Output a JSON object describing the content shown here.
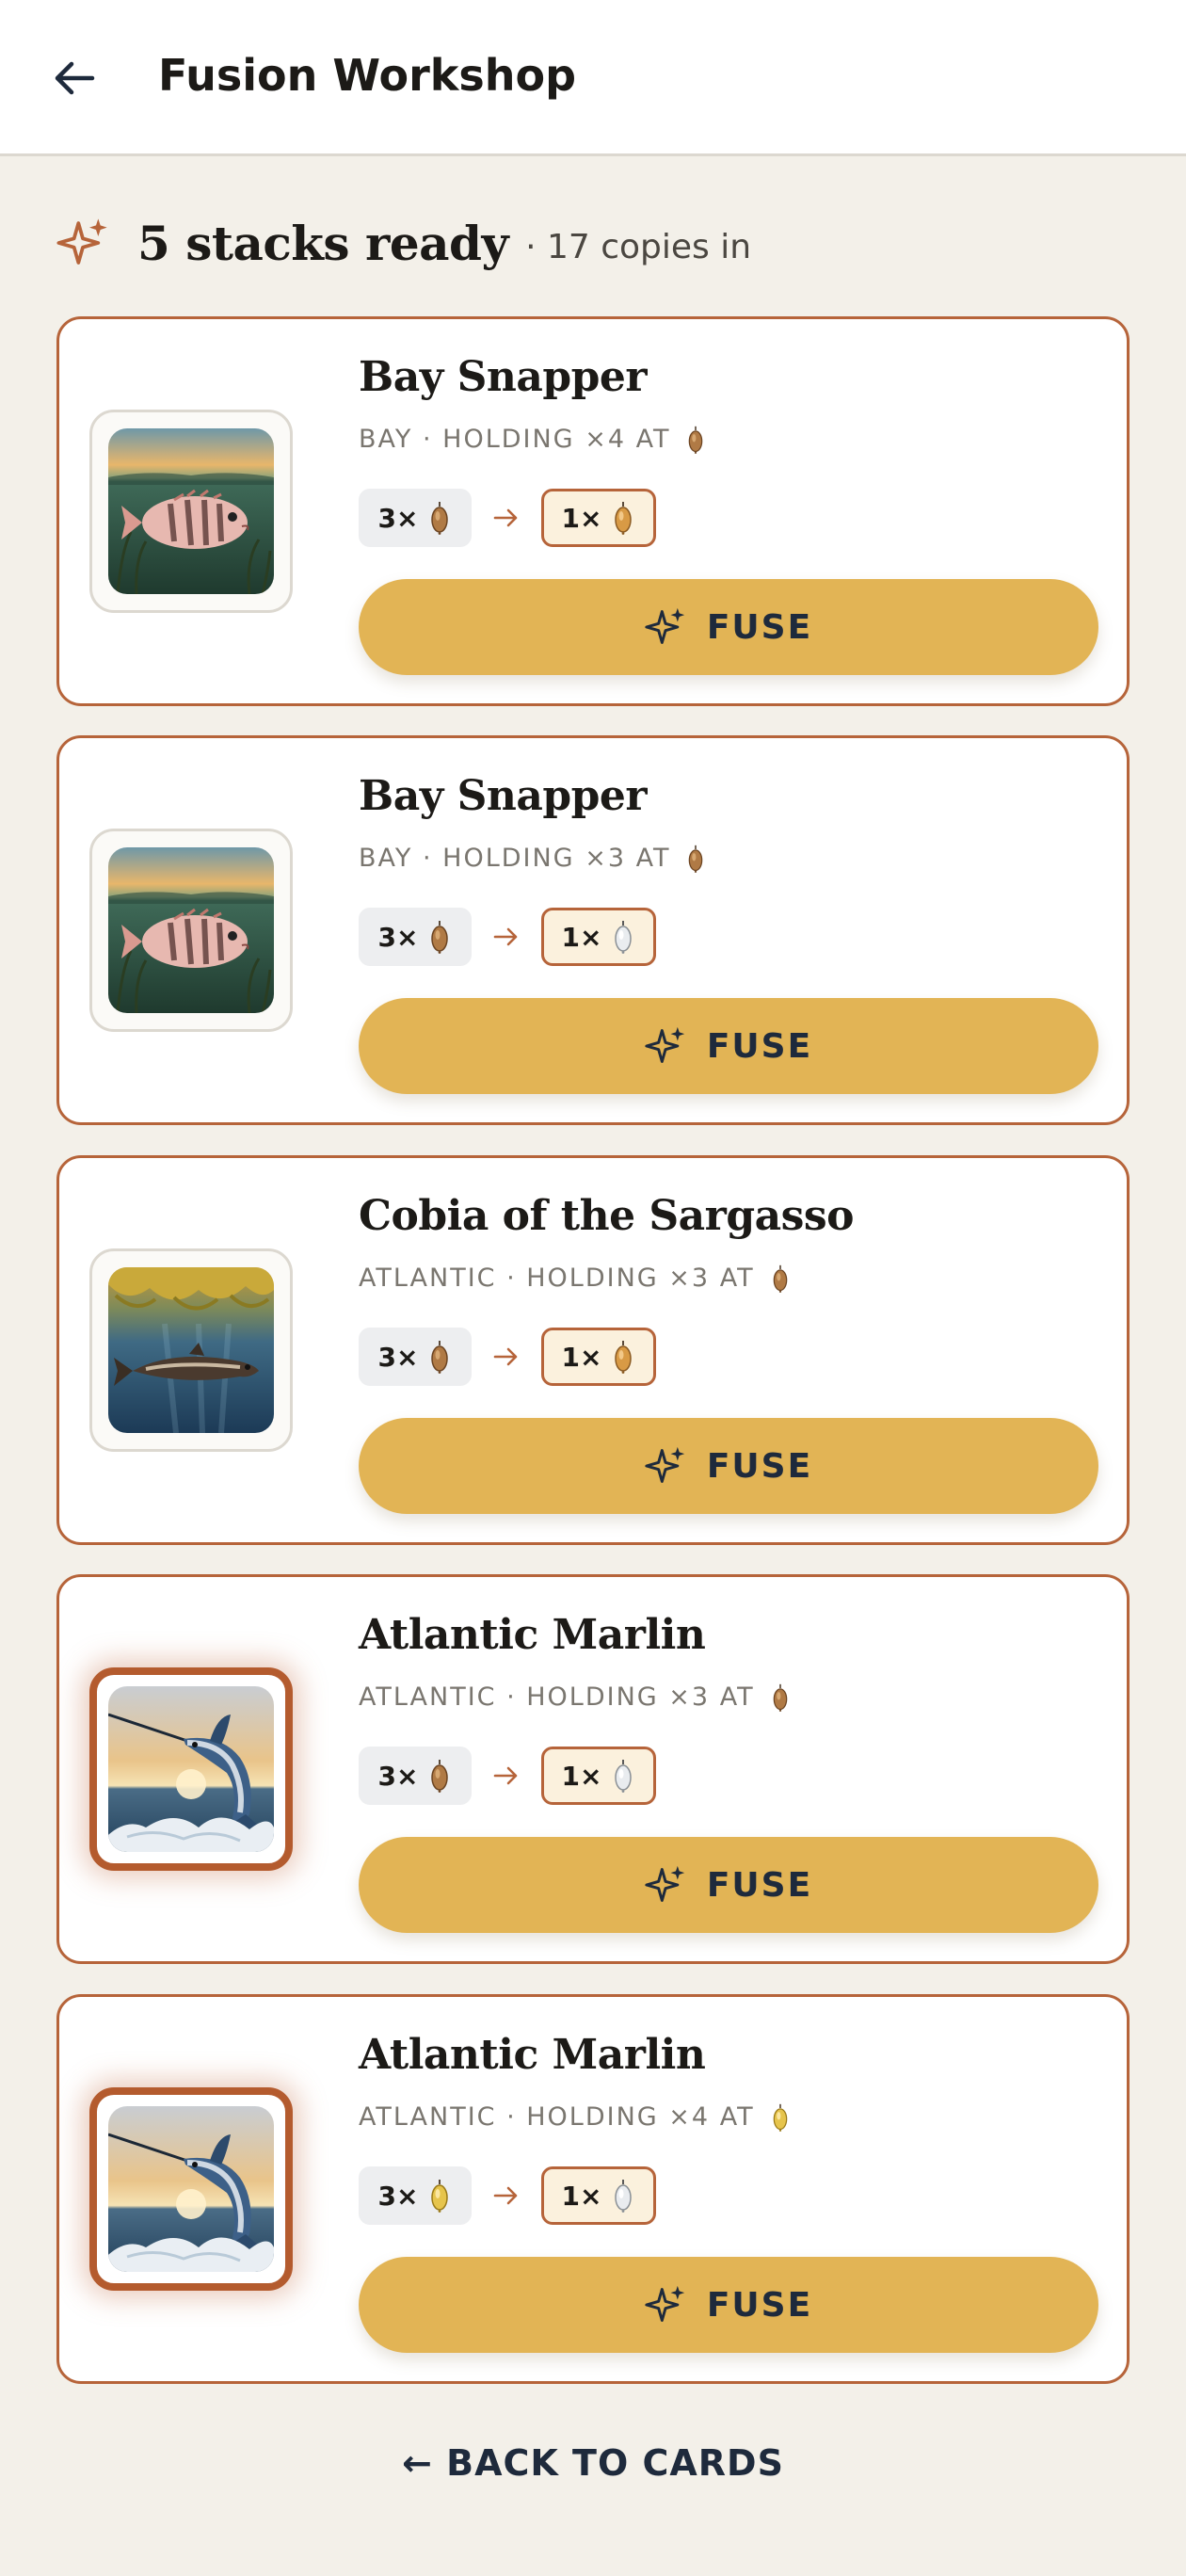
{
  "header": {
    "title": "Fusion Workshop",
    "back_icon": "arrow-left-icon"
  },
  "summary": {
    "headline": "5 stacks ready",
    "sub": "· 17 copies in",
    "icon": "sparkle-icon"
  },
  "colors": {
    "accent": "#b6643a",
    "button": "#e2b455",
    "navy": "#1e2a3c",
    "background": "#f3f0e9"
  },
  "cards": [
    {
      "title": "Bay Snapper",
      "meta": "BAY · HOLDING ×4 AT",
      "holding_tier": "bronze",
      "from_label": "3×",
      "from_tier": "bronze",
      "to_label": "1×",
      "to_tier": "gold-bronze",
      "fuse_label": "FUSE",
      "image": "bay-snapper-image",
      "highlight": false
    },
    {
      "title": "Bay Snapper",
      "meta": "BAY · HOLDING ×3 AT",
      "holding_tier": "bronze",
      "from_label": "3×",
      "from_tier": "bronze",
      "to_label": "1×",
      "to_tier": "silver",
      "fuse_label": "FUSE",
      "image": "bay-snapper-image",
      "highlight": false
    },
    {
      "title": "Cobia of the Sargasso",
      "meta": "ATLANTIC · HOLDING ×3 AT",
      "holding_tier": "bronze",
      "from_label": "3×",
      "from_tier": "bronze",
      "to_label": "1×",
      "to_tier": "gold-bronze",
      "fuse_label": "FUSE",
      "image": "cobia-image",
      "highlight": false
    },
    {
      "title": "Atlantic Marlin",
      "meta": "ATLANTIC · HOLDING ×3 AT",
      "holding_tier": "bronze",
      "from_label": "3×",
      "from_tier": "bronze",
      "to_label": "1×",
      "to_tier": "silver",
      "fuse_label": "FUSE",
      "image": "marlin-image",
      "highlight": true
    },
    {
      "title": "Atlantic Marlin",
      "meta": "ATLANTIC · HOLDING ×4 AT",
      "holding_tier": "gold",
      "from_label": "3×",
      "from_tier": "gold",
      "to_label": "1×",
      "to_tier": "silver",
      "fuse_label": "FUSE",
      "image": "marlin-image",
      "highlight": true
    }
  ],
  "footer": {
    "back_label": "← BACK TO CARDS"
  }
}
